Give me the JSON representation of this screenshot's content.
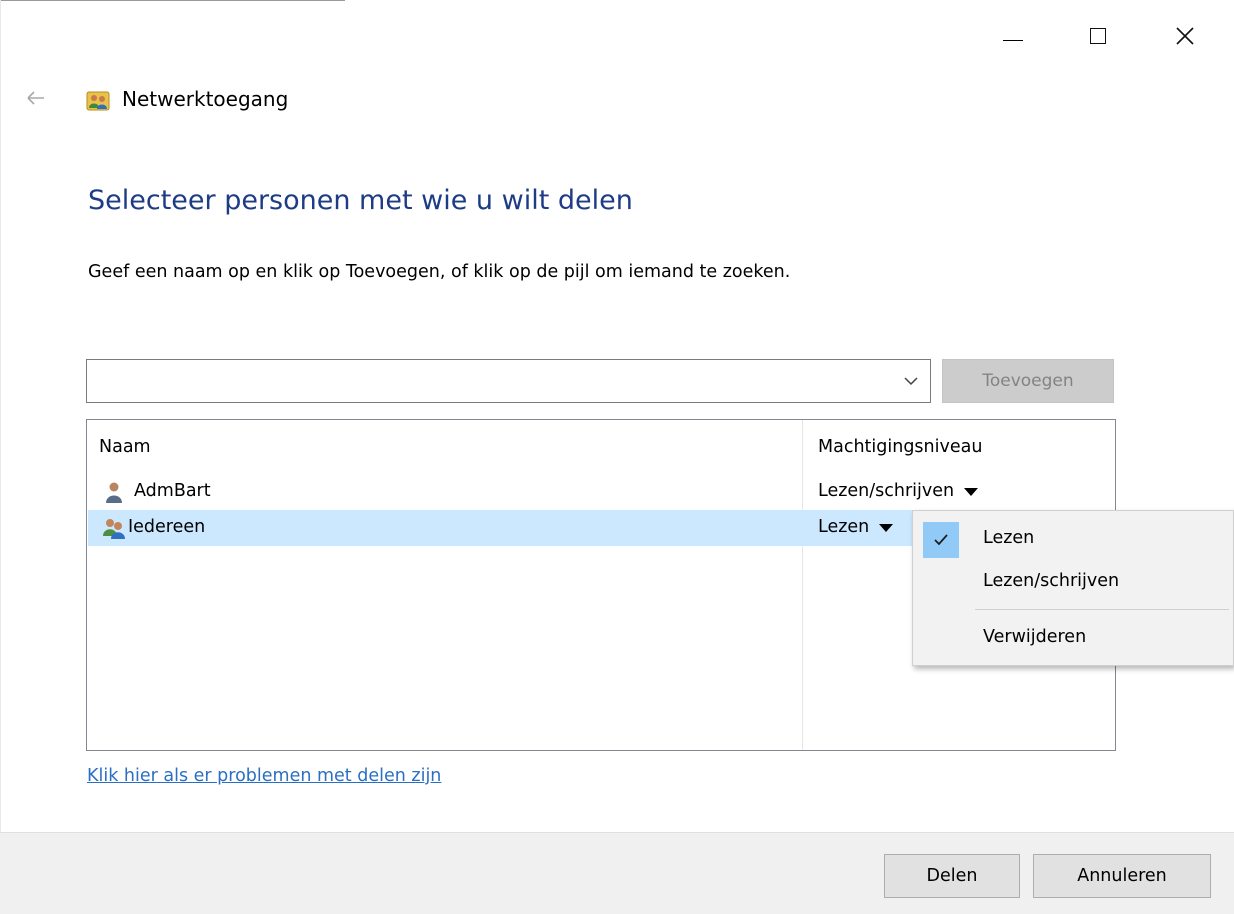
{
  "window": {
    "title": "Netwerktoegang",
    "buttons": {
      "minimize": "minimize-icon",
      "maximize": "maximize-icon",
      "close": "close-icon"
    }
  },
  "dialog": {
    "heading": "Selecteer personen met wie u wilt delen",
    "instruction": "Geef een naam op en klik op Toevoegen, of klik op de pijl om iemand te zoeken.",
    "name_input": {
      "value": "",
      "placeholder": ""
    },
    "add_button_label": "Toevoegen",
    "help_link": "Klik hier als er problemen met delen zijn"
  },
  "list": {
    "columns": [
      "Naam",
      "Machtigingsniveau"
    ],
    "rows": [
      {
        "name": "AdmBart",
        "permission": "Lezen/schrijven",
        "icon": "user-icon"
      },
      {
        "name": "Iedereen",
        "permission": "Lezen",
        "icon": "group-icon",
        "selected": true
      }
    ]
  },
  "permission_menu": {
    "items": [
      {
        "label": "Lezen",
        "checked": true
      },
      {
        "label": "Lezen/schrijven",
        "checked": false
      },
      {
        "label": "Verwijderen",
        "checked": false
      }
    ]
  },
  "footer": {
    "share_label": "Delen",
    "cancel_label": "Annuleren"
  },
  "colors": {
    "heading": "#1e3c86",
    "link": "#2b6fc4",
    "selected_row": "#cce8ff",
    "menu_check_bg": "#91c9f7",
    "footer_bg": "#f0f0f0"
  }
}
